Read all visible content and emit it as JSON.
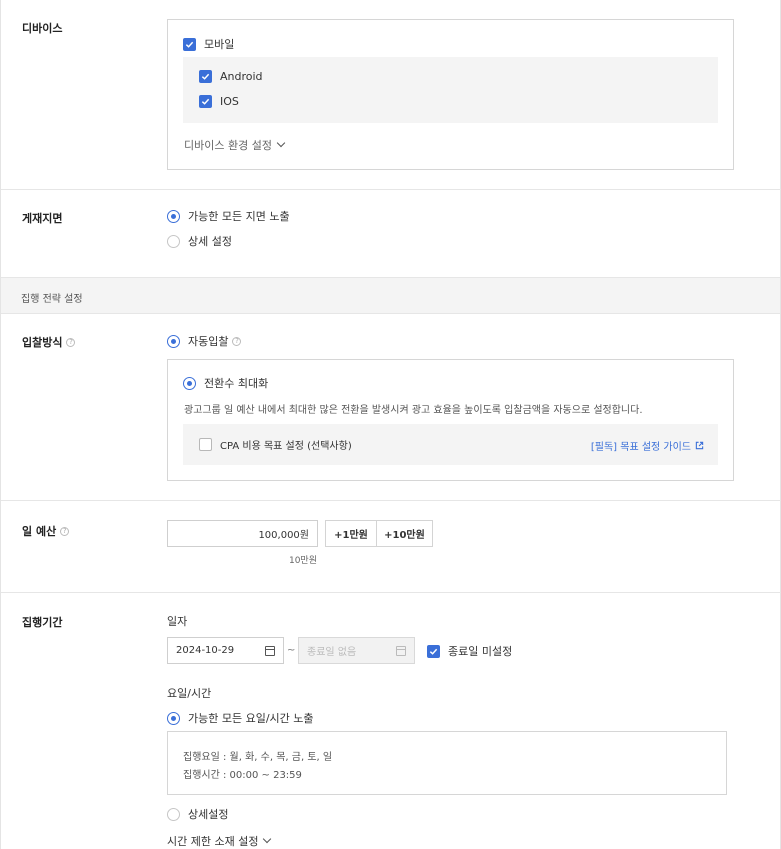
{
  "device": {
    "label": "디바이스",
    "mobile": "모바일",
    "android": "Android",
    "ios": "IOS",
    "env_settings": "디바이스 환경 설정"
  },
  "placement": {
    "label": "게재지면",
    "option_all": "가능한 모든 지면 노출",
    "option_detail": "상세 설정"
  },
  "strategy": {
    "section_title": "집행 전략 설정"
  },
  "bidding": {
    "label": "입찰방식",
    "help": "?",
    "auto_bid": "자동입찰",
    "maximize": "전환수 최대화",
    "description": "광고그룹 일 예산 내에서 최대한 많은 전환을 발생시켜 광고 효율을 높이도록 입찰금액을 자동으로 설정합니다.",
    "cpa_option": "CPA 비용 목표 설정 (선택사항)",
    "guide_link": "[필독] 목표 설정 가이드"
  },
  "budget": {
    "label": "일 예산",
    "help": "?",
    "value": "100,000원",
    "plus_10k": "+1만원",
    "plus_100k": "+10만원",
    "hint": "10만원"
  },
  "period": {
    "label": "집행기간",
    "date_label": "일자",
    "start_date": "2024-10-29",
    "tilde": "~",
    "end_placeholder": "종료일 없음",
    "no_end_date": "종료일 미설정",
    "dow_label": "요일/시간",
    "option_all": "가능한 모든 요일/시간 노출",
    "days_line": "집행요일 : 월, 화, 수, 목, 금, 토, 일",
    "time_line": "집행시간 : 00:00 ~ 23:59",
    "option_detail": "상세설정",
    "limit_settings": "시간 제한 소재 설정"
  },
  "colors": {
    "accent": "#3a6fd8"
  }
}
